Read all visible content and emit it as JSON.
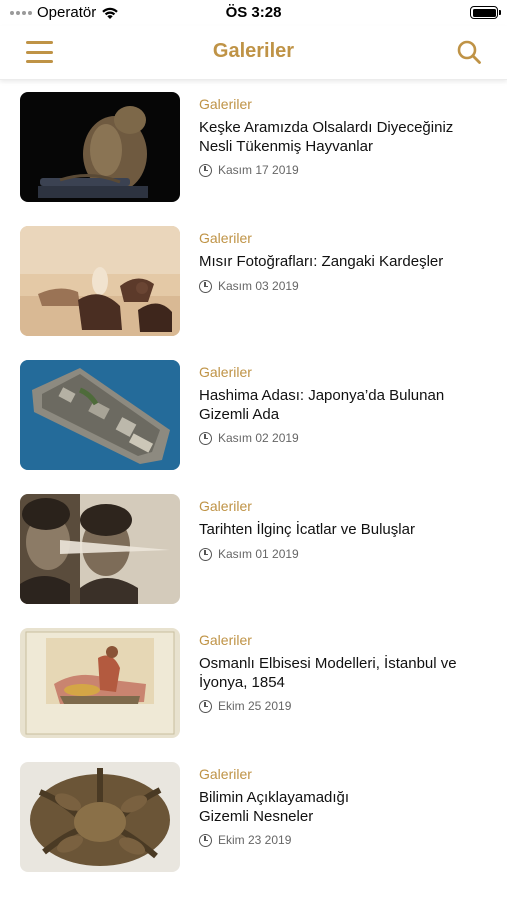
{
  "status": {
    "carrier": "Operatör",
    "time": "ÖS 3:28"
  },
  "nav": {
    "title": "Galeriler",
    "menu_icon": "hamburger-menu-icon",
    "search_icon": "search-icon"
  },
  "colors": {
    "accent": "#bf9346",
    "text": "#111111",
    "meta": "#666666"
  },
  "articles": [
    {
      "category": "Galeriler",
      "title": "Keşke Aramızda Olsalardı Diyeceğiniz Nesli Tükenmiş Hayvanlar",
      "date": "Kasım 17 2019"
    },
    {
      "category": "Galeriler",
      "title": "Mısır Fotoğrafları: Zangaki Kardeşler",
      "date": "Kasım 03 2019"
    },
    {
      "category": "Galeriler",
      "title": "Hashima Adası: Japonya’da Bulunan Gizemli Ada",
      "date": "Kasım 02 2019"
    },
    {
      "category": "Galeriler",
      "title": "Tarihten İlginç İcatlar ve Buluşlar",
      "date": "Kasım 01 2019"
    },
    {
      "category": "Galeriler",
      "title": "Osmanlı Elbisesi Modelleri, İstanbul ve İyonya, 1854",
      "date": "Ekim 25 2019"
    },
    {
      "category": "Galeriler",
      "title": "Bilimin Açıklayamadığı Gizemli Nesneler",
      "date": "Ekim 23 2019"
    }
  ]
}
